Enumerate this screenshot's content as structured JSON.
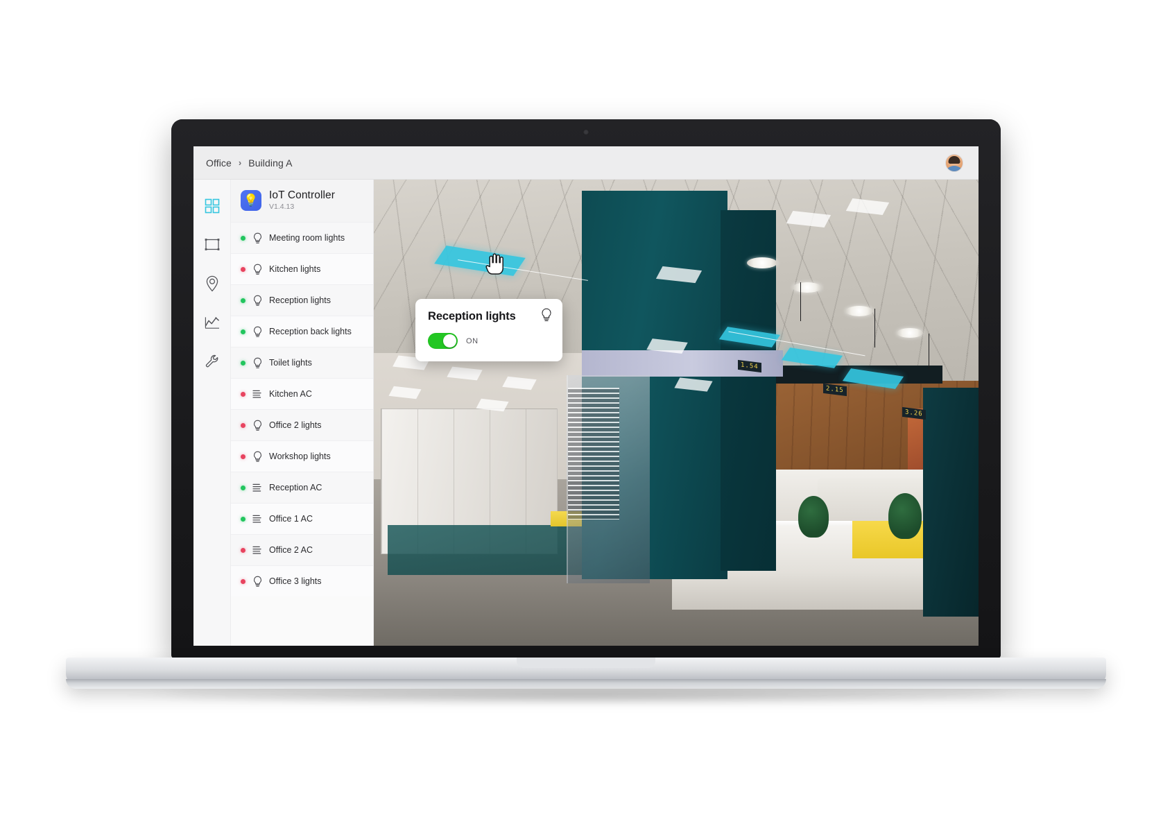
{
  "header": {
    "breadcrumb_root": "Office",
    "breadcrumb_separator": "›",
    "breadcrumb_current": "Building A",
    "avatar_name": "user-avatar"
  },
  "rail": {
    "items": [
      {
        "icon": "grid-icon",
        "name": "dashboard",
        "active": true
      },
      {
        "icon": "rectangle-icon",
        "name": "floorplan",
        "active": false
      },
      {
        "icon": "location-pin-icon",
        "name": "locations",
        "active": false
      },
      {
        "icon": "line-chart-icon",
        "name": "analytics",
        "active": false
      },
      {
        "icon": "wrench-icon",
        "name": "settings",
        "active": false
      }
    ]
  },
  "app": {
    "icon": "lightbulb-app-icon",
    "name": "IoT Controller",
    "version": "V1.4.13"
  },
  "devices": [
    {
      "label": "Meeting room lights",
      "status": "on",
      "type": "bulb-icon"
    },
    {
      "label": "Kitchen lights",
      "status": "off",
      "type": "bulb-icon"
    },
    {
      "label": "Reception lights",
      "status": "on",
      "type": "bulb-icon"
    },
    {
      "label": "Reception back lights",
      "status": "on",
      "type": "bulb-icon"
    },
    {
      "label": "Toilet lights",
      "status": "on",
      "type": "bulb-icon"
    },
    {
      "label": "Kitchen AC",
      "status": "off",
      "type": "ac-icon"
    },
    {
      "label": "Office 2 lights",
      "status": "off",
      "type": "bulb-icon"
    },
    {
      "label": "Workshop lights",
      "status": "off",
      "type": "bulb-icon"
    },
    {
      "label": "Reception AC",
      "status": "on",
      "type": "ac-icon"
    },
    {
      "label": "Office 1 AC",
      "status": "on",
      "type": "ac-icon"
    },
    {
      "label": "Office 2 AC",
      "status": "off",
      "type": "ac-icon"
    },
    {
      "label": "Office 3 lights",
      "status": "off",
      "type": "bulb-icon"
    }
  ],
  "popup": {
    "title": "Reception lights",
    "toggle_state": "ON",
    "toggle_on": true,
    "icon": "bulb-outline-icon"
  },
  "viewport": {
    "scene_labels": [
      "1.54",
      "2.15",
      "3.26"
    ],
    "selected_panel": "reception-ceiling-panel",
    "cursor": "pointing-hand-cursor"
  },
  "colors": {
    "accent_teal": "#35c6e0",
    "status_on": "#22c55e",
    "status_off": "#e8435f",
    "toggle_green": "#23c723",
    "app_icon_blue": "#4f74f2"
  }
}
